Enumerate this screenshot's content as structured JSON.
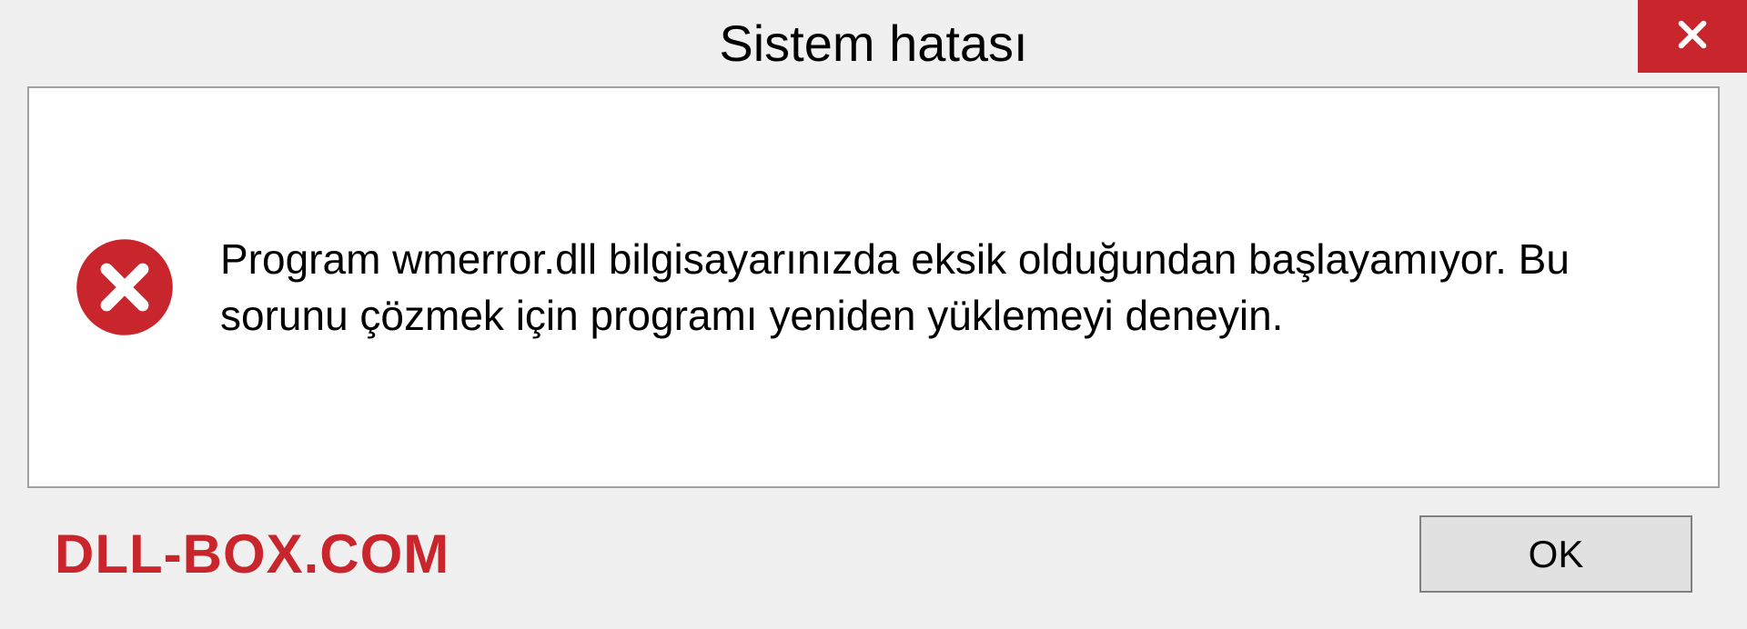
{
  "dialog": {
    "title": "Sistem hatası",
    "message": "Program wmerror.dll bilgisayarınızda eksik olduğundan başlayamıyor. Bu sorunu çözmek için programı yeniden yüklemeyi deneyin.",
    "ok_label": "OK"
  },
  "watermark": "DLL-BOX.COM",
  "colors": {
    "close_button": "#c9252c",
    "watermark": "#c9252c"
  }
}
